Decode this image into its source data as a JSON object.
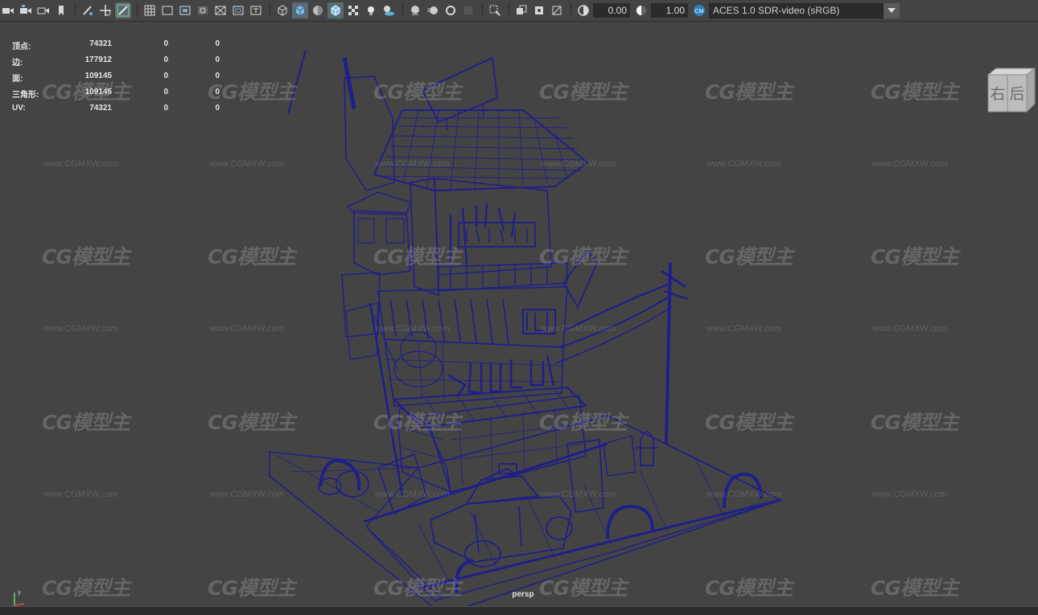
{
  "toolbar": {
    "icons": [
      "camera-icon",
      "camera-attributes-icon",
      "bookmark-camera-icon",
      "image-plane-icon",
      "bookmark-icon",
      "grease-pencil-icon",
      "pan-zoom-icon",
      "2d-pan-icon",
      "grid-icon",
      "film-gate-icon",
      "resolution-gate-icon",
      "gate-mask-icon",
      "field-chart-icon",
      "safe-action-icon",
      "safe-title-icon",
      "wireframe-icon",
      "smooth-shade-icon",
      "flat-shade-icon",
      "wireframe-on-shaded-icon",
      "textured-icon",
      "lights-icon",
      "shadows-icon",
      "ambient-occlusion-icon",
      "motion-blur-icon",
      "anti-alias-icon",
      "depth-of-field-icon",
      "isolate-select-icon",
      "xray-icon",
      "xray-joints-icon",
      "backface-icon",
      "exposure-icon",
      "gamma-icon",
      "color-management-icon",
      "dropdown-arrow-icon"
    ],
    "exposure_value": "0.00",
    "gamma_value": "1.00",
    "view_transform": "ACES 1.0 SDR-video (sRGB)"
  },
  "hud": {
    "rows": [
      {
        "label": "顶点:",
        "v1": "74321",
        "v2": "0",
        "v3": "0"
      },
      {
        "label": "边:",
        "v1": "177912",
        "v2": "0",
        "v3": "0"
      },
      {
        "label": "面:",
        "v1": "109145",
        "v2": "0",
        "v3": "0"
      },
      {
        "label": "三角形:",
        "v1": "109145",
        "v2": "0",
        "v3": "0"
      },
      {
        "label": "UV:",
        "v1": "74321",
        "v2": "0",
        "v3": "0"
      }
    ]
  },
  "viewcube": {
    "right_label": "右",
    "back_label": "后"
  },
  "camera_label": "persp",
  "axis": {
    "y": "y",
    "x": "x"
  },
  "watermark": {
    "logo": "CG模型主",
    "url": "www.CGMXW.com"
  },
  "colors": {
    "wireframe": "#1f1f8a",
    "background": "#444444",
    "toolbar": "#444444"
  }
}
